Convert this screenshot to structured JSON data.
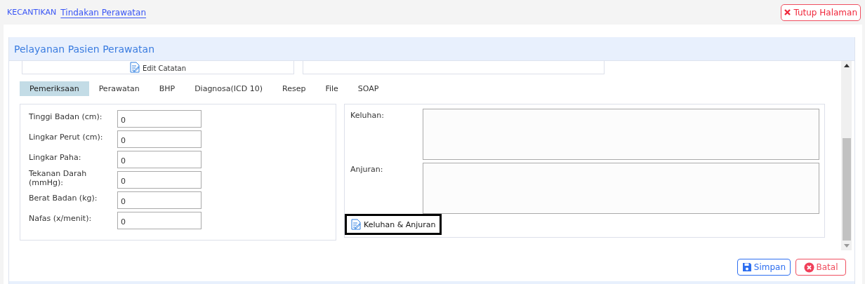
{
  "breadcrumb": [
    {
      "label": "KECANTIKAN",
      "selected": false
    },
    {
      "label": "Tindakan Perawatan",
      "selected": true
    }
  ],
  "close_button": {
    "label": "Tutup Halaman"
  },
  "panel": {
    "title": "Pelayanan Pasien Perawatan"
  },
  "edit_note": {
    "label": "Edit Catatan"
  },
  "tabs": [
    {
      "label": "Pemeriksaan",
      "selected": true
    },
    {
      "label": "Perawatan",
      "selected": false
    },
    {
      "label": "BHP",
      "selected": false
    },
    {
      "label": "Diagnosa(ICD 10)",
      "selected": false
    },
    {
      "label": "Resep",
      "selected": false
    },
    {
      "label": "File",
      "selected": false
    },
    {
      "label": "SOAP",
      "selected": false
    }
  ],
  "measurements": [
    {
      "label": "Tinggi Badan (cm):",
      "value": "0"
    },
    {
      "label": "Lingkar Perut (cm):",
      "value": "0"
    },
    {
      "label": "Lingkar Paha:",
      "value": "0"
    },
    {
      "label": "Tekanan Darah (mmHg):",
      "value": "0"
    },
    {
      "label": "Berat Badan (kg):",
      "value": "0"
    },
    {
      "label": "Nafas (x/menit):",
      "value": "0"
    }
  ],
  "notes": [
    {
      "label": "Keluhan:"
    },
    {
      "label": "Anjuran:"
    }
  ],
  "notes_button": {
    "label": "Keluhan & Anjuran"
  },
  "footer_buttons": [
    {
      "kind": "save",
      "label": "Simpan"
    },
    {
      "kind": "cancel",
      "label": "Batal"
    }
  ]
}
